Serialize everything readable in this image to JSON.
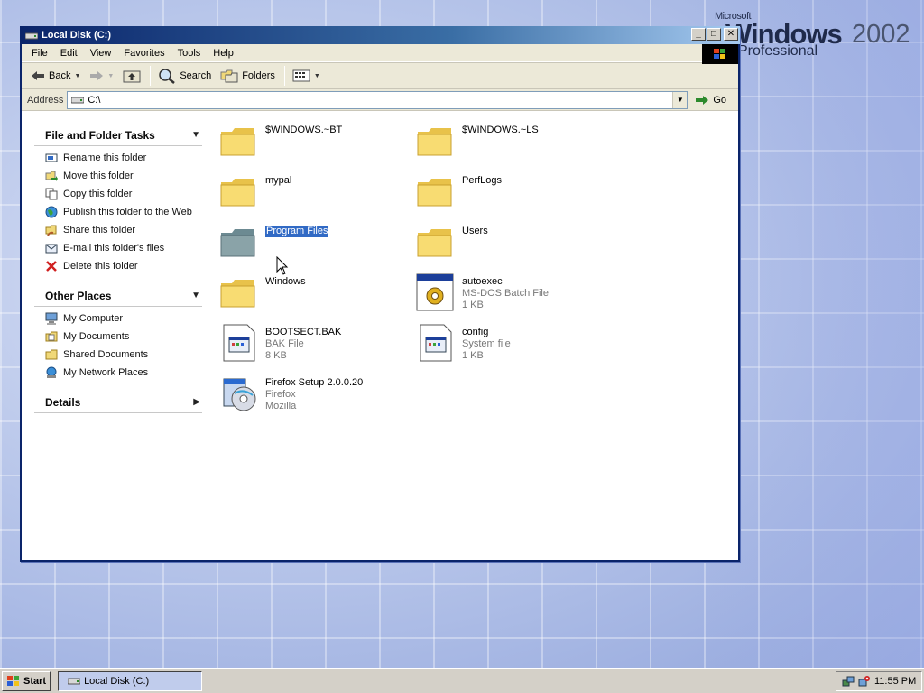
{
  "desktop": {
    "brand_microsoft": "Microsoft",
    "brand_windows": "Windows",
    "brand_year": "2002",
    "brand_edition": "Professional"
  },
  "window": {
    "title": "Local Disk (C:)",
    "menu": [
      "File",
      "Edit",
      "View",
      "Favorites",
      "Tools",
      "Help"
    ],
    "toolbar": {
      "back_label": "Back",
      "search_label": "Search",
      "folders_label": "Folders"
    },
    "address": {
      "label": "Address",
      "value": "C:\\",
      "go_label": "Go"
    }
  },
  "taskpane": {
    "file_folder_tasks": {
      "title": "File and Folder Tasks",
      "items": [
        {
          "label": "Rename this folder",
          "icon": "rename-icon"
        },
        {
          "label": "Move this folder",
          "icon": "move-icon"
        },
        {
          "label": "Copy this folder",
          "icon": "copy-icon"
        },
        {
          "label": "Publish this folder to the Web",
          "icon": "globe-icon"
        },
        {
          "label": "Share this folder",
          "icon": "share-icon"
        },
        {
          "label": "E-mail this folder's files",
          "icon": "email-icon"
        },
        {
          "label": "Delete this folder",
          "icon": "delete-icon"
        }
      ]
    },
    "other_places": {
      "title": "Other Places",
      "items": [
        {
          "label": "My Computer",
          "icon": "computer-icon"
        },
        {
          "label": "My Documents",
          "icon": "documents-icon"
        },
        {
          "label": "Shared Documents",
          "icon": "folder-icon"
        },
        {
          "label": "My Network Places",
          "icon": "network-icon"
        }
      ]
    },
    "details": {
      "title": "Details"
    }
  },
  "files": [
    {
      "name": "$WINDOWS.~BT",
      "type": "",
      "size": "",
      "icon": "folder-icon"
    },
    {
      "name": "$WINDOWS.~LS",
      "type": "",
      "size": "",
      "icon": "folder-icon"
    },
    {
      "name": "mypal",
      "type": "",
      "size": "",
      "icon": "folder-icon"
    },
    {
      "name": "PerfLogs",
      "type": "",
      "size": "",
      "icon": "folder-icon"
    },
    {
      "name": "Program Files",
      "type": "",
      "size": "",
      "icon": "folder-icon",
      "selected": true
    },
    {
      "name": "Users",
      "type": "",
      "size": "",
      "icon": "folder-icon"
    },
    {
      "name": "Windows",
      "type": "",
      "size": "",
      "icon": "folder-icon"
    },
    {
      "name": "autoexec",
      "type": "MS-DOS Batch File",
      "size": "1 KB",
      "icon": "batch-file-icon"
    },
    {
      "name": "BOOTSECT.BAK",
      "type": "BAK File",
      "size": "8 KB",
      "icon": "file-icon"
    },
    {
      "name": "config",
      "type": "System file",
      "size": "1 KB",
      "icon": "file-icon"
    },
    {
      "name": "Firefox Setup 2.0.0.20",
      "type": "Firefox",
      "size": "Mozilla",
      "icon": "installer-icon"
    }
  ],
  "taskbar": {
    "start_label": "Start",
    "task_label": "Local Disk (C:)",
    "clock": "11:55 PM"
  },
  "colors": {
    "title_blue": "#0a246a",
    "selection": "#316ac5",
    "folder_yellow": "#f5d76a"
  }
}
